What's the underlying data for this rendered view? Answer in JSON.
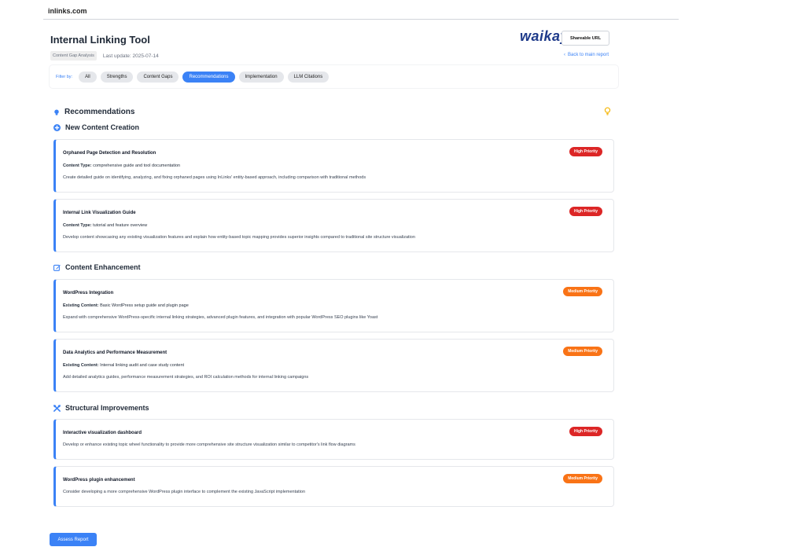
{
  "site": {
    "name": "inlinks.com"
  },
  "header": {
    "title": "Internal Linking Tool",
    "tag": "Content Gap Analysis",
    "updated": "Last update: 2025-07-14",
    "brand": "waikay",
    "share_label": "Shareable URL",
    "back_arrow": "‹",
    "back_label": "Back to main report"
  },
  "filters": {
    "label": "Filter by:",
    "items": [
      "All",
      "Strengths",
      "Content Gaps",
      "Recommendations",
      "Implementation",
      "LLM Citations"
    ],
    "active": "Recommendations"
  },
  "recommendations": {
    "title": "Recommendations",
    "new_content": {
      "title": "New Content Creation",
      "cards": [
        {
          "title": "Orphaned Page Detection and Resolution",
          "meta_label": "Content Type:",
          "meta_value": "comprehensive guide and tool documentation",
          "desc": "Create detailed guide on identifying, analyzing, and fixing orphaned pages using InLinks' entity-based approach, including comparison with traditional methods",
          "priority": "High Priority"
        },
        {
          "title": "Internal Link Visualization Guide",
          "meta_label": "Content Type:",
          "meta_value": "tutorial and feature overview",
          "desc": "Develop content showcasing any existing visualization features and explain how entity-based topic mapping provides superior insights compared to traditional site structure visualization",
          "priority": "High Priority"
        }
      ]
    },
    "enhancement": {
      "title": "Content Enhancement",
      "cards": [
        {
          "title": "WordPress Integration",
          "meta_label": "Existing Content:",
          "meta_value": "Basic WordPress setup guide and plugin page",
          "desc": "Expand with comprehensive WordPress-specific internal linking strategies, advanced plugin features, and integration with popular WordPress SEO plugins like Yoast",
          "priority": "Medium Priority"
        },
        {
          "title": "Data Analytics and Performance Measurement",
          "meta_label": "Existing Content:",
          "meta_value": "Internal linking audit and case study content",
          "desc": "Add detailed analytics guides, performance measurement strategies, and ROI calculation methods for internal linking campaigns",
          "priority": "Medium Priority"
        }
      ]
    },
    "structural": {
      "title": "Structural Improvements",
      "cards": [
        {
          "title": "Interactive visualization dashboard",
          "desc": "Develop or enhance existing topic wheel functionality to provide more comprehensive site structure visualization similar to competitor's link flow diagrams",
          "priority": "High Priority"
        },
        {
          "title": "WordPress plugin enhancement",
          "desc": "Consider developing a more comprehensive WordPress plugin interface to complement the existing JavaScript implementation",
          "priority": "Medium Priority"
        }
      ]
    }
  },
  "footer": {
    "assess_label": "Assess Report"
  },
  "colors": {
    "accent": "#3b82f6",
    "high": "#dc2626",
    "medium": "#f97316",
    "bulb": "#f5b400"
  }
}
